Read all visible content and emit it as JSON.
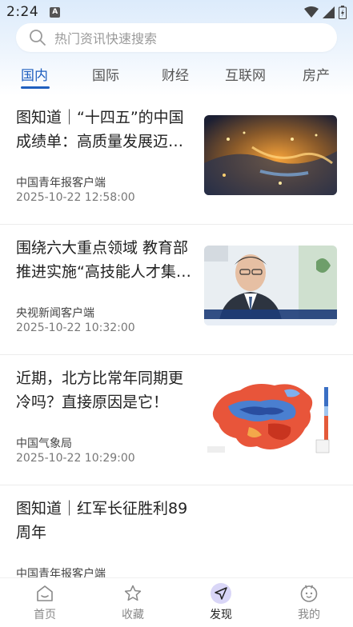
{
  "status_bar": {
    "time": "2:24",
    "notification_icon": "A"
  },
  "search": {
    "placeholder": "热门资讯快速搜索"
  },
  "tabs": [
    {
      "label": "国内",
      "active": true
    },
    {
      "label": "国际",
      "active": false
    },
    {
      "label": "财经",
      "active": false
    },
    {
      "label": "互联网",
      "active": false
    },
    {
      "label": "房产",
      "active": false
    }
  ],
  "news": [
    {
      "title": "图知道｜“十四五”的中国成绩单：高质量发展迈…",
      "source": "中国青年报客户端",
      "time": "2025-10-22 12:58:00",
      "thumb": "night-city-photo"
    },
    {
      "title": "围绕六大重点领域 教育部推进实施“高技能人才集…",
      "source": "央视新闻客户端",
      "time": "2025-10-22 10:32:00",
      "thumb": "interview-photo"
    },
    {
      "title": "近期，北方比常年同期更冷吗？直接原因是它！",
      "source": "中国气象局",
      "time": "2025-10-22 10:29:00",
      "thumb": "temperature-map"
    },
    {
      "title": "图知道｜红军长征胜利89周年",
      "source": "中国青年报客户端",
      "time": "",
      "thumb": ""
    }
  ],
  "bottom_nav": [
    {
      "label": "首页",
      "icon": "home-icon",
      "active": false
    },
    {
      "label": "收藏",
      "icon": "star-icon",
      "active": false
    },
    {
      "label": "发现",
      "icon": "send-icon",
      "active": true
    },
    {
      "label": "我的",
      "icon": "profile-icon",
      "active": false
    }
  ],
  "colors": {
    "accent": "#1f5fbf",
    "discover_bg": "#d9d6f7"
  }
}
